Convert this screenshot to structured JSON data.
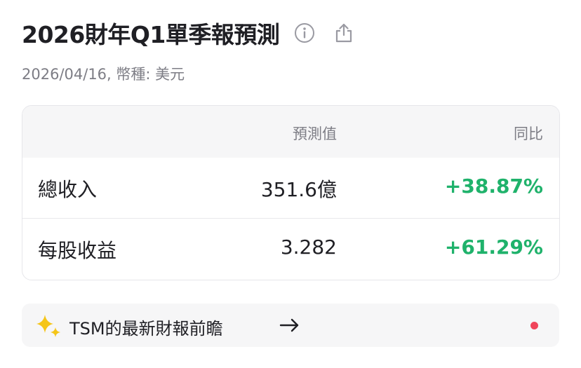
{
  "header": {
    "title": "2026財年Q1單季報預測",
    "info_icon": "info-circle-icon",
    "share_icon": "share-icon",
    "subtitle": "2026/04/16, 幣種: 美元"
  },
  "table": {
    "columns": [
      "",
      "預測值",
      "同比"
    ],
    "rows": [
      {
        "label": "總收入",
        "forecast": "351.6億",
        "yoy": "+38.87%"
      },
      {
        "label": "每股收益",
        "forecast": "3.282",
        "yoy": "+61.29%"
      }
    ]
  },
  "banner": {
    "icon": "sparkle-icon",
    "text": "TSM的最新財報前瞻",
    "arrow_icon": "arrow-right-icon",
    "has_notification_dot": true
  },
  "colors": {
    "positive": "#1fb26b",
    "notification_dot": "#f0445a",
    "muted_text": "#7d7d85",
    "sparkle": "#f5c518"
  }
}
